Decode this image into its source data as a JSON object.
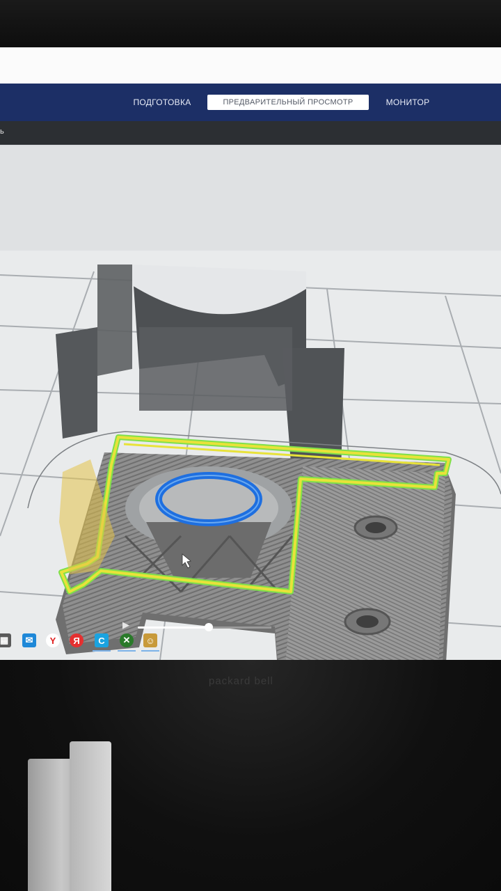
{
  "app": {
    "stage_tabs": [
      {
        "label": "ПОДГОТОВКА",
        "active": false
      },
      {
        "label": "ПРЕДВАРИТЕЛЬНЫЙ ПРОСМОТР",
        "active": true
      },
      {
        "label": "МОНИТОР",
        "active": false
      }
    ],
    "toolbar": {
      "label_fragment": "ь"
    },
    "accent_color": "#1c2f66"
  },
  "layer_view": {
    "colors": {
      "outer_wall": "#e8e23a",
      "inner_wall": "#7fe04a",
      "skin": "#1e6fe0",
      "infill_gray": "#8e8e8e",
      "model_shadow": "#5a5d60",
      "support_ghost": "#e4c24a"
    }
  },
  "playback": {
    "play_icon": "play-icon",
    "progress_fraction": 0.53
  },
  "taskbar": {
    "icons": [
      "store-icon",
      "mail-icon",
      "yandex-browser-icon",
      "yandex-icon",
      "cura-icon",
      "xbox-icon",
      "user-app-icon"
    ]
  },
  "monitor_brand": "packard bell"
}
